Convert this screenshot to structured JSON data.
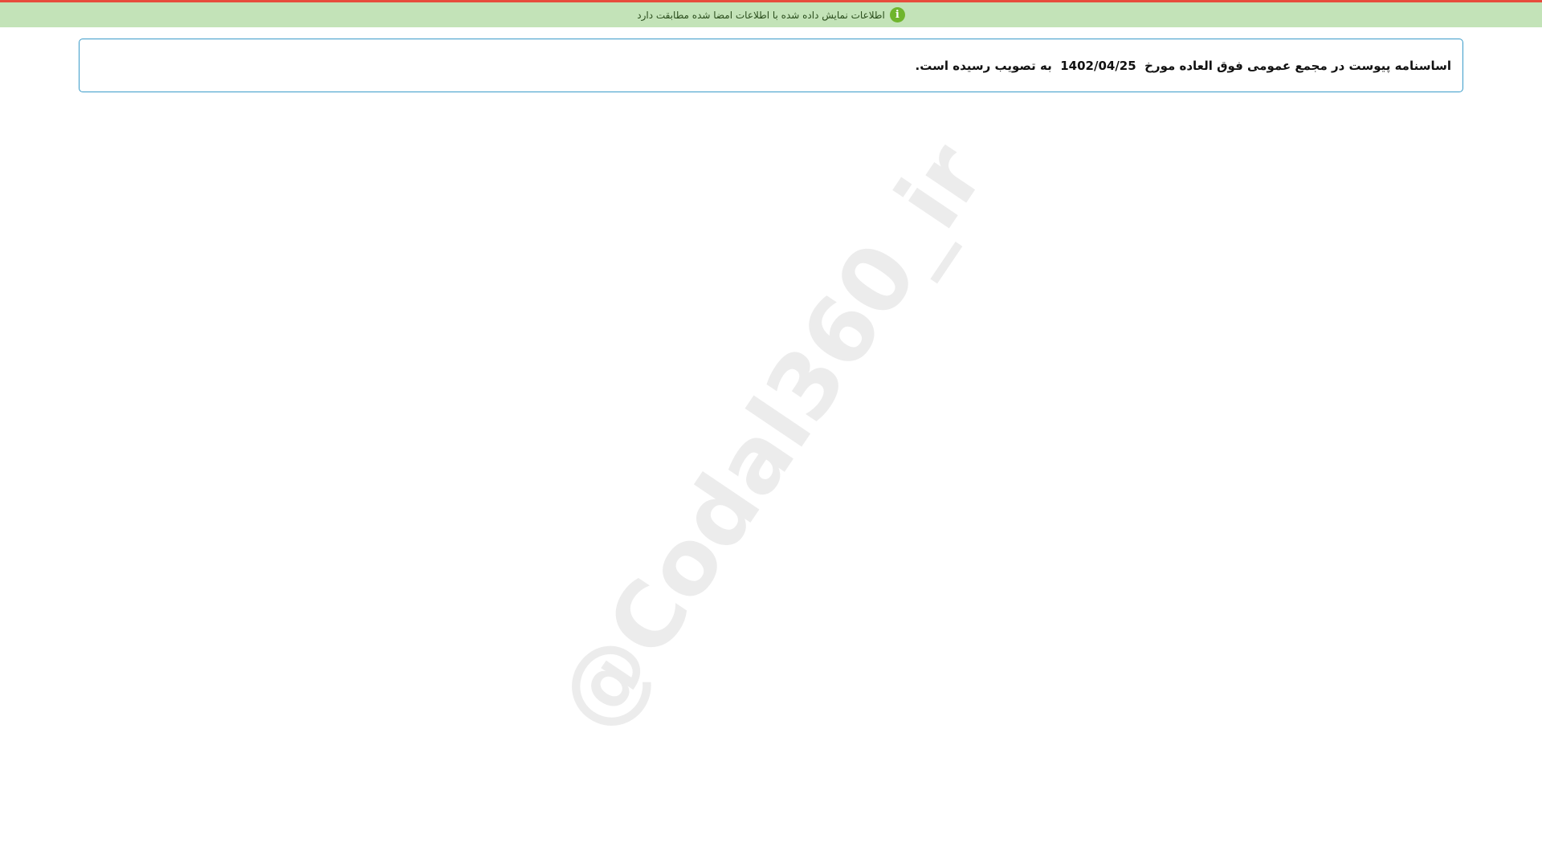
{
  "banner": {
    "icon": "info-icon",
    "icon_glyph": "i",
    "text": "اطلاعات نمایش داده شده با اطلاعات امضا شده مطابقت دارد",
    "accent_color": "#e74c3c",
    "background_color": "#c3e3b8",
    "icon_color": "#6fb52c"
  },
  "notice": {
    "text_before_date": "اساسنامه پیوست در مجمع عمومی فوق العاده مورخ",
    "date": "1402/04/25",
    "text_after_date": "به تصویب رسیده است.",
    "border_color": "#3a9bc9"
  },
  "watermark": {
    "text": "@Codal360_ir"
  }
}
